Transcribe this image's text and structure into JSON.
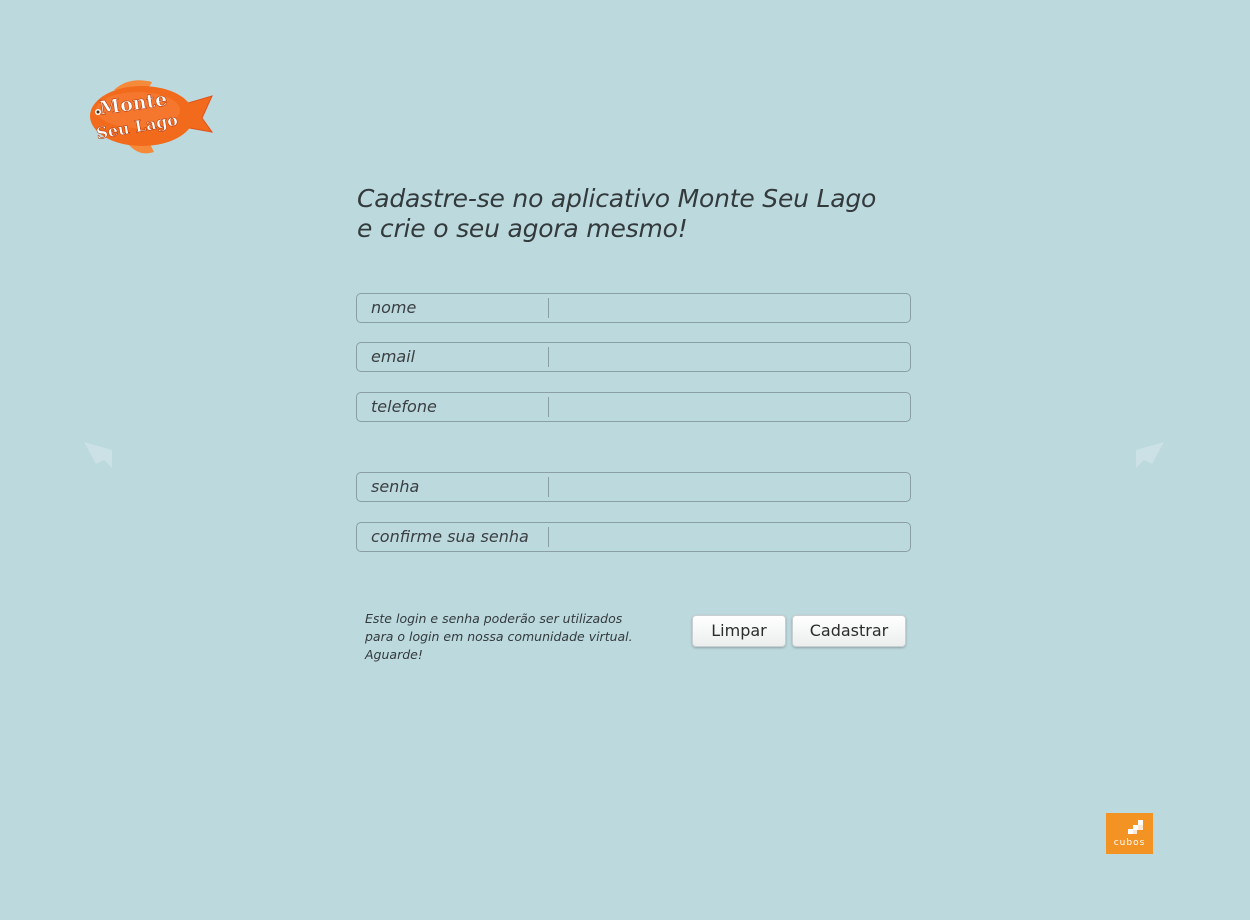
{
  "logo": {
    "line1": "Monte",
    "line2": "Seu Lago"
  },
  "heading": {
    "line1": "Cadastre-se no aplicativo Monte Seu Lago",
    "line2": "e crie o seu agora mesmo!"
  },
  "form": {
    "fields": [
      {
        "label": "nome",
        "value": "",
        "type": "text"
      },
      {
        "label": "email",
        "value": "",
        "type": "email"
      },
      {
        "label": "telefone",
        "value": "",
        "type": "tel"
      },
      {
        "label": "senha",
        "value": "",
        "type": "password"
      },
      {
        "label": "confirme sua senha",
        "value": "",
        "type": "password"
      }
    ]
  },
  "note": {
    "line1": "Este login e senha poderão ser utilizados",
    "line2": "para o login em nossa comunidade virtual.",
    "line3": "Aguarde!"
  },
  "buttons": {
    "clear_label": "Limpar",
    "submit_label": "Cadastrar"
  },
  "footer": {
    "brand": "cubos"
  },
  "icons": {
    "prev": "arrow-left-icon",
    "next": "arrow-right-icon"
  },
  "colors": {
    "background": "#bcd9de",
    "logo_orange": "#f26a1b",
    "badge_orange": "#f39324",
    "field_border": "#8a9fa4"
  }
}
